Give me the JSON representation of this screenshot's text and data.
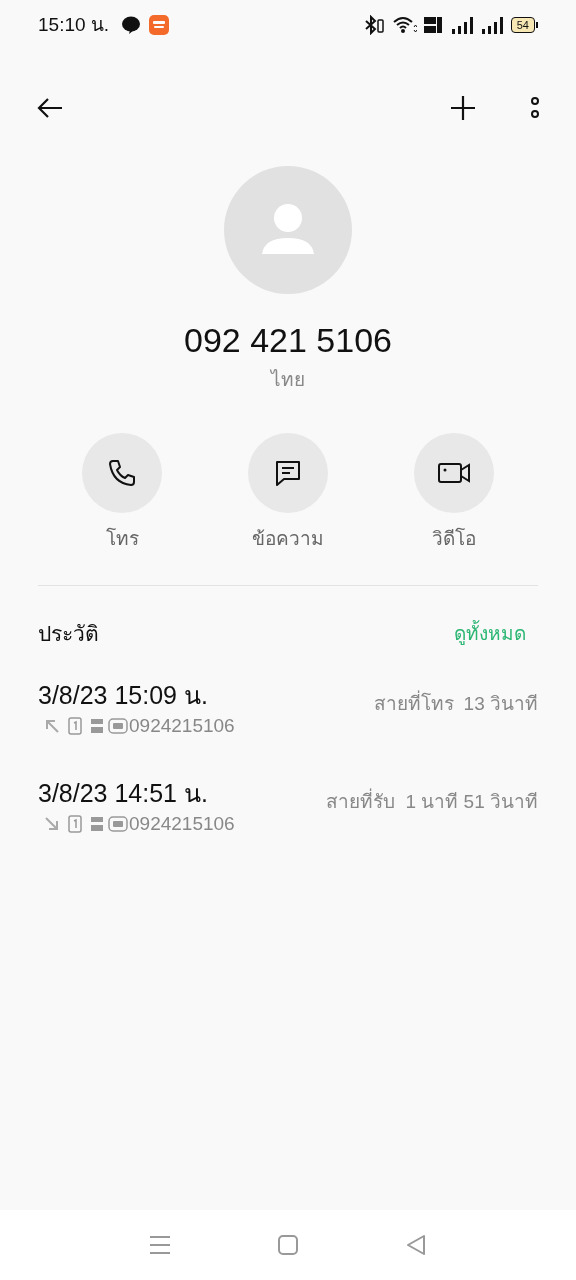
{
  "status_bar": {
    "time": "15:10 น.",
    "battery": "54"
  },
  "contact": {
    "number": "092 421 5106",
    "location": "ไทย"
  },
  "actions": [
    {
      "kind": "call",
      "label": "โทร"
    },
    {
      "kind": "message",
      "label": "ข้อความ"
    },
    {
      "kind": "video",
      "label": "วิดีโอ"
    }
  ],
  "history": {
    "title": "ประวัติ",
    "view_all": "ดูทั้งหมด",
    "calls": [
      {
        "datetime": "3/8/23 15:09 น.",
        "kind": "outgoing",
        "number": "0924215106",
        "type": "สายที่โทร",
        "duration": "13 วินาที"
      },
      {
        "datetime": "3/8/23 14:51 น.",
        "kind": "incoming",
        "number": "0924215106",
        "type": "สายที่รับ",
        "duration": "1 นาที 51 วินาที"
      }
    ]
  }
}
